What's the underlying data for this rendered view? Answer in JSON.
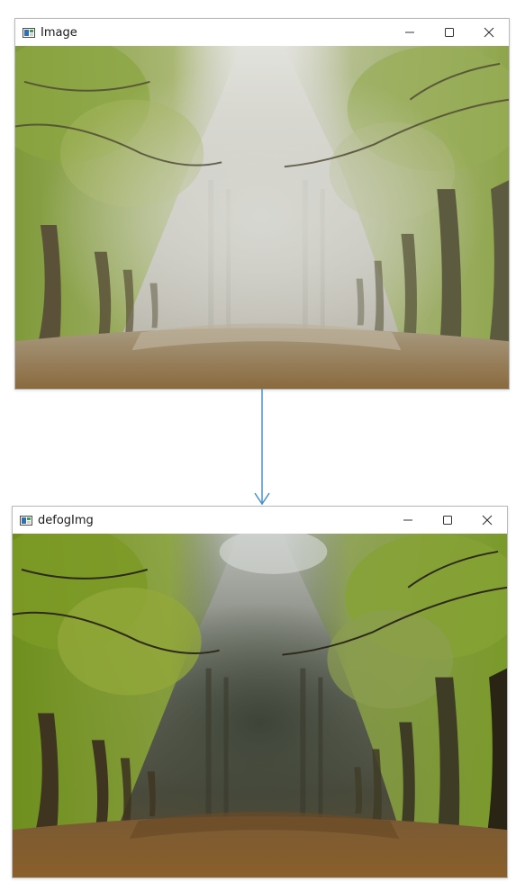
{
  "windows": [
    {
      "title": "Image",
      "icon": "opencv-window-icon",
      "image_description_tag": "foggy-forest-path",
      "controls": [
        "minimize",
        "maximize",
        "close"
      ]
    },
    {
      "title": "defogImg",
      "icon": "opencv-window-icon",
      "image_description_tag": "defogged-forest-path",
      "controls": [
        "minimize",
        "maximize",
        "close"
      ]
    }
  ],
  "arrow": {
    "direction": "down",
    "color": "#4a90c8"
  },
  "colors": {
    "window_border": "#b9b9b9",
    "titlebar_bg": "#ffffff",
    "control_glyph": "#333333"
  }
}
